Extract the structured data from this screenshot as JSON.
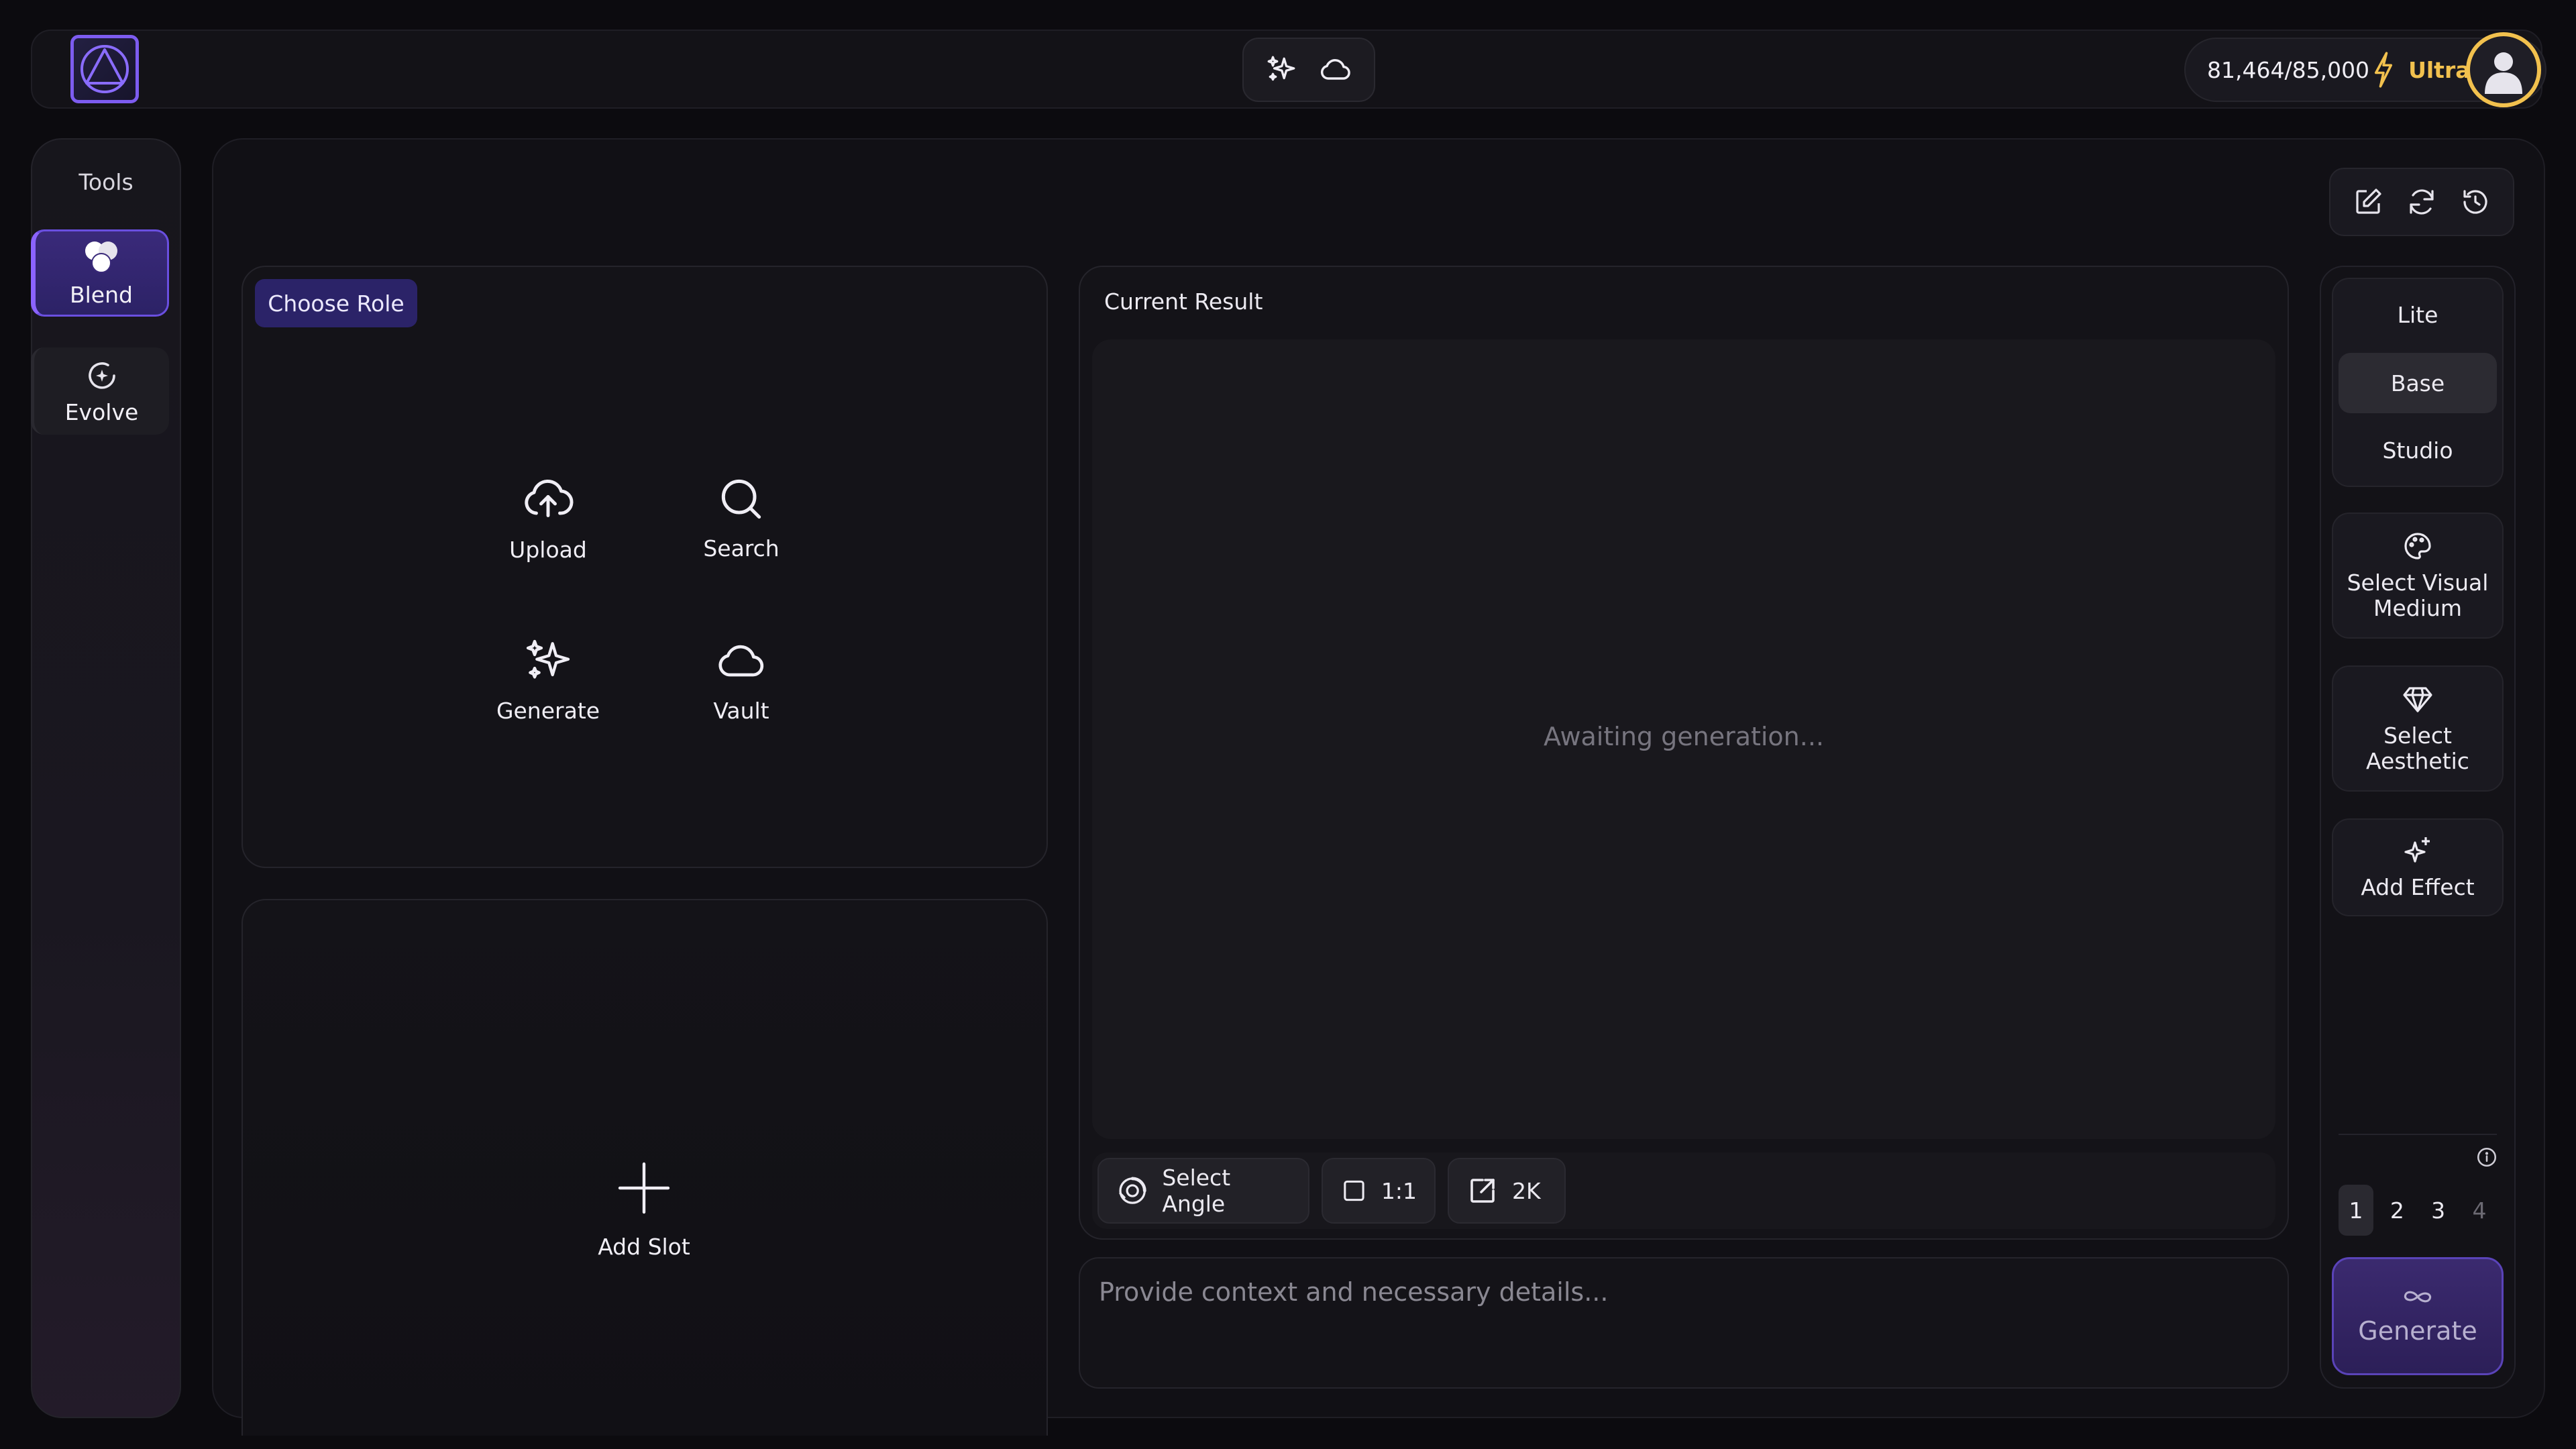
{
  "header": {
    "credits": "81,464/85,000",
    "plan": "Ultra"
  },
  "sidebar": {
    "title": "Tools",
    "items": [
      {
        "label": "Blend",
        "active": true
      },
      {
        "label": "Evolve",
        "active": false
      }
    ]
  },
  "role_panel": {
    "badge": "Choose Role",
    "options": [
      {
        "label": "Upload",
        "icon": "cloud-upload-icon"
      },
      {
        "label": "Search",
        "icon": "search-icon"
      },
      {
        "label": "Generate",
        "icon": "sparkles-icon"
      },
      {
        "label": "Vault",
        "icon": "cloud-icon"
      }
    ]
  },
  "slot_panel": {
    "add_label": "Add Slot"
  },
  "result": {
    "title": "Current Result",
    "status": "Awaiting generation...",
    "controls": {
      "angle_label": "Select Angle",
      "ratio_label": "1:1",
      "resolution_label": "2K"
    }
  },
  "prompt": {
    "placeholder": "Provide context and necessary details..."
  },
  "settings": {
    "quality": [
      {
        "label": "Lite",
        "active": false
      },
      {
        "label": "Base",
        "active": true
      },
      {
        "label": "Studio",
        "active": false
      }
    ],
    "visual_medium_label": "Select Visual Medium",
    "aesthetic_label": "Select Aesthetic",
    "effect_label": "Add Effect",
    "counts": [
      {
        "label": "1",
        "active": true
      },
      {
        "label": "2",
        "active": false
      },
      {
        "label": "3",
        "active": false
      },
      {
        "label": "4",
        "active": false,
        "disabled": true
      }
    ],
    "generate_label": "Generate"
  },
  "colors": {
    "accent": "#6a4fe0",
    "plan_gold": "#f2c14e",
    "background": "#0c0b0f"
  }
}
